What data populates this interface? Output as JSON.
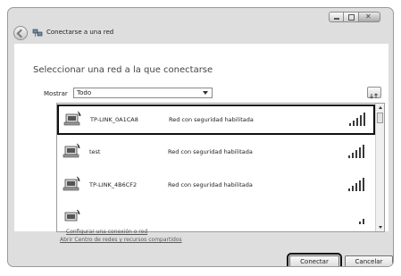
{
  "window": {
    "title": "Conectarse a una red"
  },
  "heading": "Seleccionar una red a la que conectarse",
  "filter": {
    "label": "Mostrar",
    "selected": "Todo"
  },
  "networks": [
    {
      "name": "TP-LINK_0A1CA8",
      "security": "Red con seguridad habilitada",
      "selected": true
    },
    {
      "name": "test",
      "security": "Red con seguridad habilitada",
      "selected": false
    },
    {
      "name": "TP-LINK_4B6CF2",
      "security": "Red con seguridad habilitada",
      "selected": false
    },
    {
      "name": "",
      "security": "",
      "selected": false
    }
  ],
  "links": {
    "configure": "Configurar una conexión o red",
    "network_center": "Abrir Centro de redes y recursos compartidos"
  },
  "buttons": {
    "connect": "Conectar",
    "cancel": "Cancelar"
  }
}
